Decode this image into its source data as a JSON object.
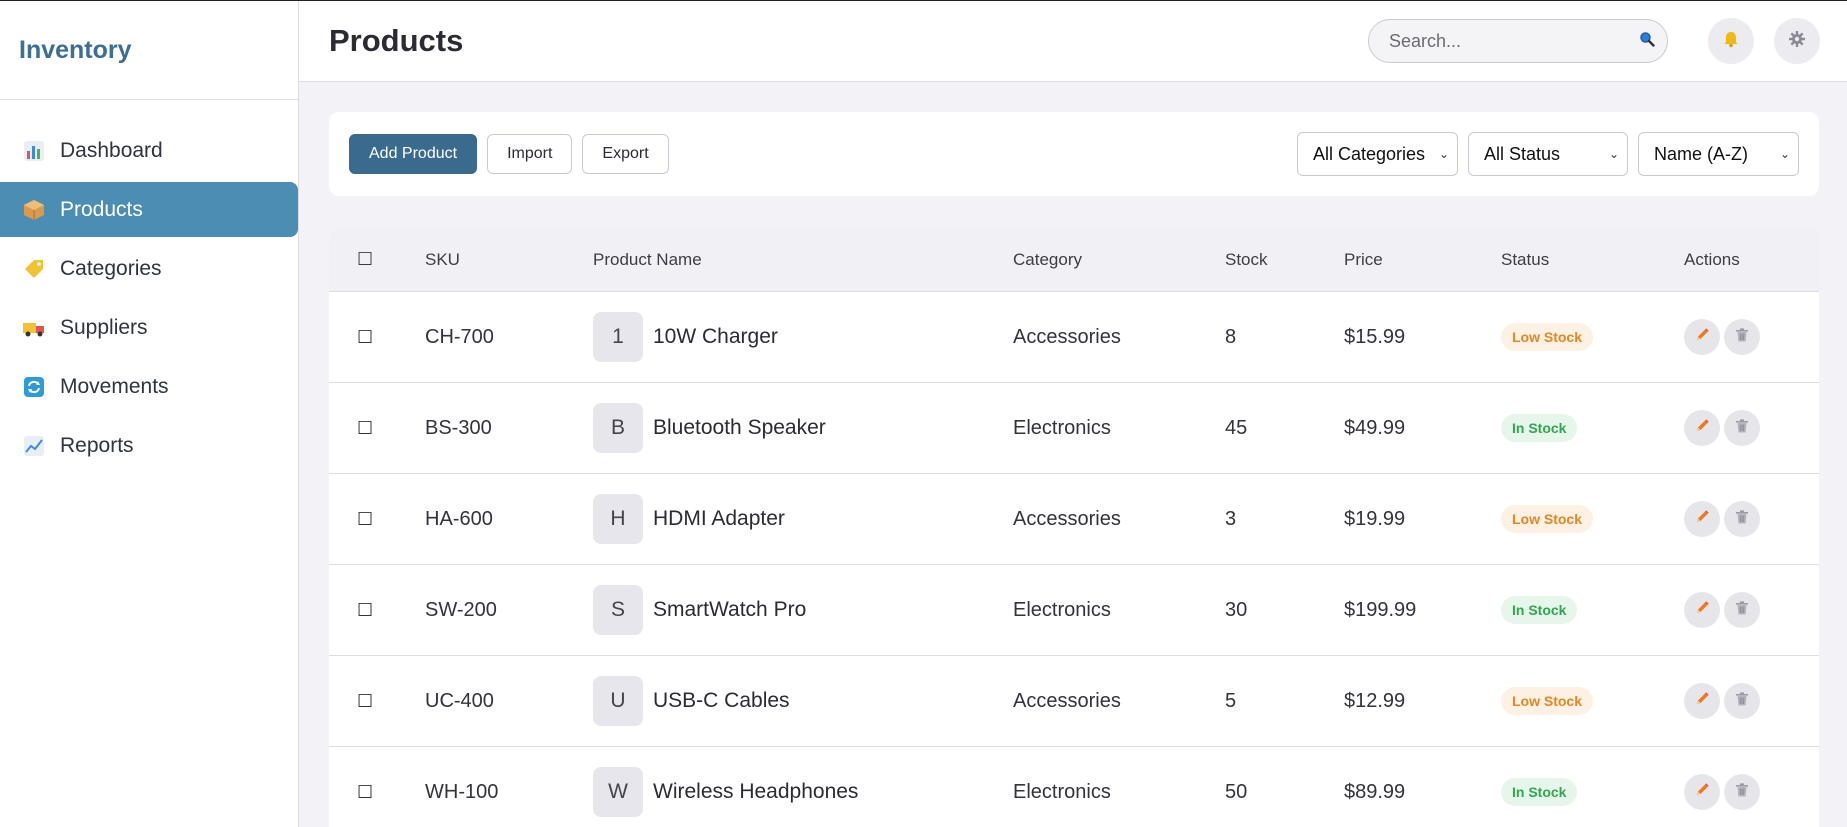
{
  "sidebar": {
    "brand": "Inventory",
    "items": [
      {
        "label": "Dashboard",
        "icon": "bar-chart-icon"
      },
      {
        "label": "Products",
        "icon": "package-icon"
      },
      {
        "label": "Categories",
        "icon": "tag-icon"
      },
      {
        "label": "Suppliers",
        "icon": "truck-icon"
      },
      {
        "label": "Movements",
        "icon": "refresh-icon"
      },
      {
        "label": "Reports",
        "icon": "line-chart-icon"
      }
    ],
    "active": "Products"
  },
  "header": {
    "title": "Products",
    "search_placeholder": "Search...",
    "icons": [
      "search-icon",
      "bell-icon",
      "gear-icon"
    ]
  },
  "toolbar": {
    "add_label": "Add Product",
    "import_label": "Import",
    "export_label": "Export",
    "category_filter": "All Categories",
    "status_filter": "All Status",
    "sort": "Name (A-Z)"
  },
  "table": {
    "headers": {
      "select": "☐",
      "sku": "SKU",
      "name": "Product Name",
      "category": "Category",
      "stock": "Stock",
      "price": "Price",
      "status": "Status",
      "actions": "Actions"
    },
    "rows": [
      {
        "check": "☐",
        "sku": "CH-700",
        "initial": "1",
        "name": "10W Charger",
        "category": "Accessories",
        "stock": "8",
        "price": "$15.99",
        "status": "Low Stock"
      },
      {
        "check": "☐",
        "sku": "BS-300",
        "initial": "B",
        "name": "Bluetooth Speaker",
        "category": "Electronics",
        "stock": "45",
        "price": "$49.99",
        "status": "In Stock"
      },
      {
        "check": "☐",
        "sku": "HA-600",
        "initial": "H",
        "name": "HDMI Adapter",
        "category": "Accessories",
        "stock": "3",
        "price": "$19.99",
        "status": "Low Stock"
      },
      {
        "check": "☐",
        "sku": "SW-200",
        "initial": "S",
        "name": "SmartWatch Pro",
        "category": "Electronics",
        "stock": "30",
        "price": "$199.99",
        "status": "In Stock"
      },
      {
        "check": "☐",
        "sku": "UC-400",
        "initial": "U",
        "name": "USB-C Cables",
        "category": "Accessories",
        "stock": "5",
        "price": "$12.99",
        "status": "Low Stock"
      },
      {
        "check": "☐",
        "sku": "WH-100",
        "initial": "W",
        "name": "Wireless Headphones",
        "category": "Electronics",
        "stock": "50",
        "price": "$89.99",
        "status": "In Stock"
      }
    ]
  },
  "colors": {
    "brand": "#3b6f96",
    "active_nav": "#4b8db3",
    "primary_button": "#3a6a8d",
    "low_stock_text": "#e8861f",
    "low_stock_bg": "#fdf1e3",
    "in_stock_text": "#2fa84f",
    "in_stock_bg": "#e6f6ea"
  }
}
